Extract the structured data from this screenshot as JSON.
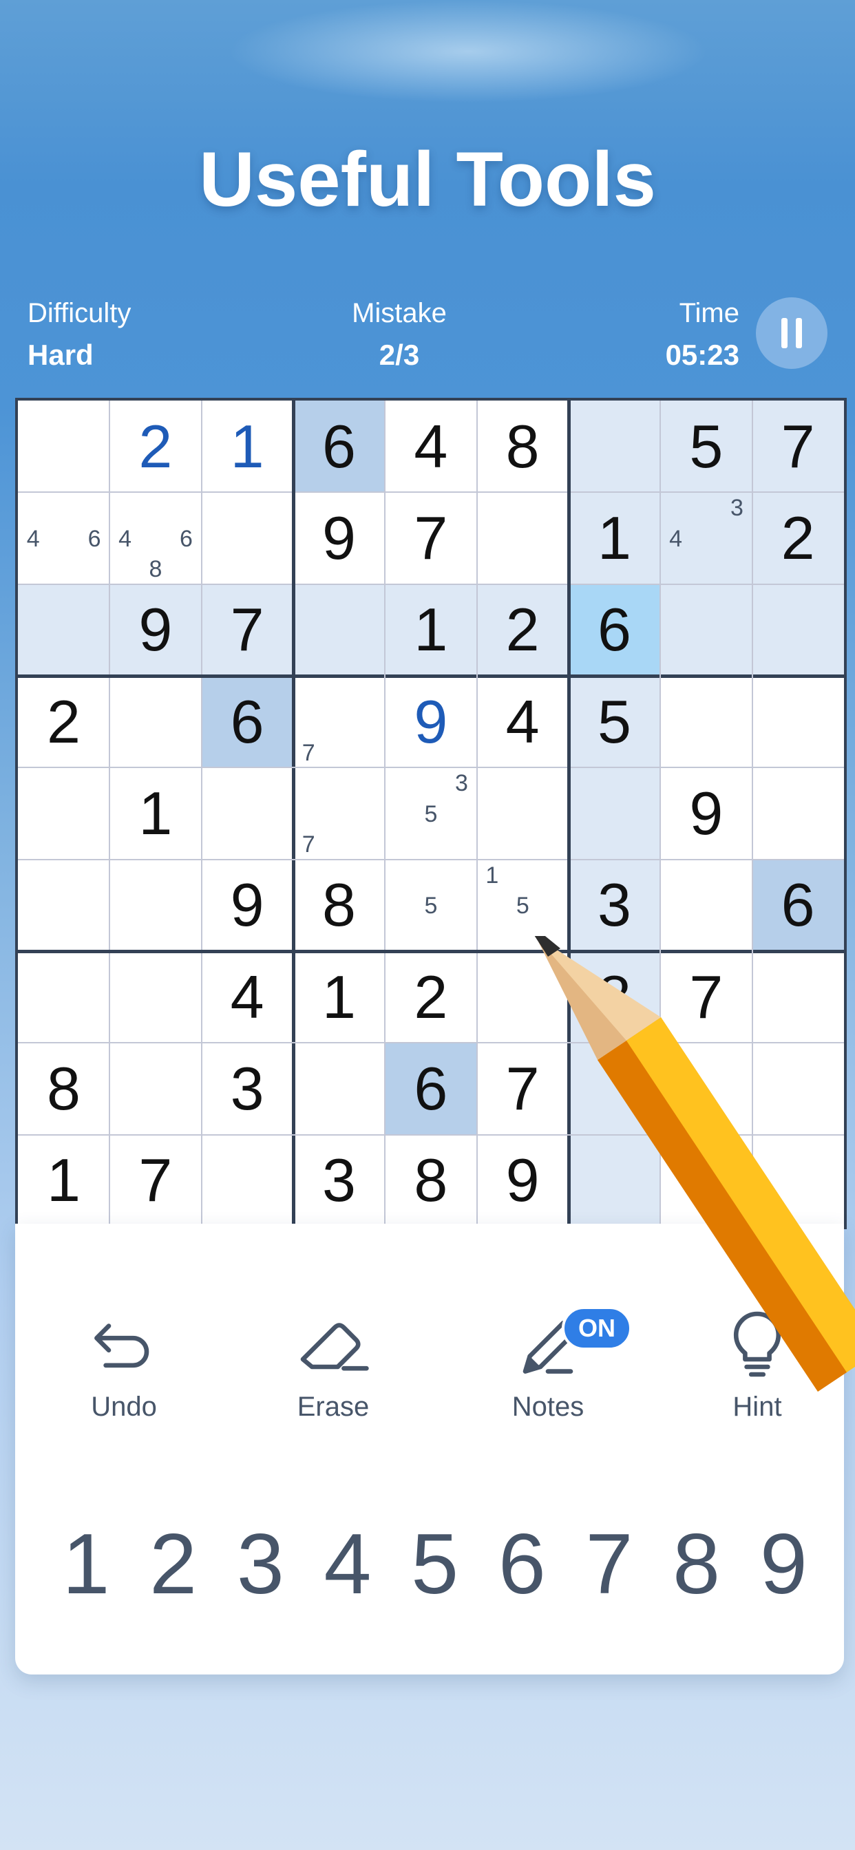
{
  "promo": {
    "headline": "Useful Tools"
  },
  "status": {
    "difficulty_label": "Difficulty",
    "difficulty_value": "Hard",
    "mistake_label": "Mistake",
    "mistake_value": "2/3",
    "time_label": "Time",
    "time_value": "05:23",
    "pause_icon": "pause-icon"
  },
  "board": {
    "rows": [
      [
        "",
        "2",
        "1",
        "6",
        "4",
        "8",
        "",
        "5",
        "7"
      ],
      [
        "",
        "",
        "",
        "9",
        "7",
        "",
        "1",
        "",
        "2"
      ],
      [
        "",
        "9",
        "7",
        "",
        "1",
        "2",
        "6",
        "",
        ""
      ],
      [
        "2",
        "",
        "6",
        "",
        "9",
        "4",
        "5",
        "",
        ""
      ],
      [
        "",
        "1",
        "",
        "",
        "",
        "",
        "",
        "9",
        ""
      ],
      [
        "",
        "",
        "9",
        "8",
        "",
        "",
        "3",
        "",
        "6"
      ],
      [
        "",
        "",
        "4",
        "1",
        "2",
        "",
        "8",
        "7",
        ""
      ],
      [
        "8",
        "",
        "3",
        "",
        "6",
        "7",
        "",
        "",
        ""
      ],
      [
        "1",
        "7",
        "",
        "3",
        "8",
        "9",
        "",
        "",
        ""
      ]
    ],
    "user_entered": [
      [
        0,
        1
      ],
      [
        0,
        2
      ],
      [
        3,
        4
      ]
    ],
    "highlight_colors": {
      "row_col_box": "#dde8f5",
      "same_number": "#b6cfea",
      "selected": "#a9d7f6"
    },
    "notes": [
      {
        "row": 1,
        "col": 0,
        "digits": [
          "4",
          "6"
        ]
      },
      {
        "row": 1,
        "col": 1,
        "digits": [
          "4",
          "6",
          "8"
        ]
      },
      {
        "row": 1,
        "col": 7,
        "digits": [
          "3",
          "4"
        ]
      },
      {
        "row": 3,
        "col": 3,
        "digits": [
          "7"
        ]
      },
      {
        "row": 4,
        "col": 3,
        "digits": [
          "7"
        ]
      },
      {
        "row": 4,
        "col": 4,
        "digits": [
          "3",
          "5"
        ]
      },
      {
        "row": 5,
        "col": 4,
        "digits": [
          "5"
        ]
      },
      {
        "row": 5,
        "col": 5,
        "digits": [
          "1",
          "5"
        ]
      }
    ]
  },
  "tools": {
    "undo": {
      "label": "Undo",
      "icon": "undo-icon"
    },
    "erase": {
      "label": "Erase",
      "icon": "eraser-icon"
    },
    "notes": {
      "label": "Notes",
      "icon": "pencil-icon",
      "badge": "ON"
    },
    "hint": {
      "label": "Hint",
      "icon": "lightbulb-icon"
    }
  },
  "numpad": [
    "1",
    "2",
    "3",
    "4",
    "5",
    "6",
    "7",
    "8",
    "9"
  ],
  "colors": {
    "accent": "#2f7ee6",
    "user_digit": "#1e5bb7",
    "grid_thick": "#334155",
    "grid_thin": "#c3c7d6"
  }
}
